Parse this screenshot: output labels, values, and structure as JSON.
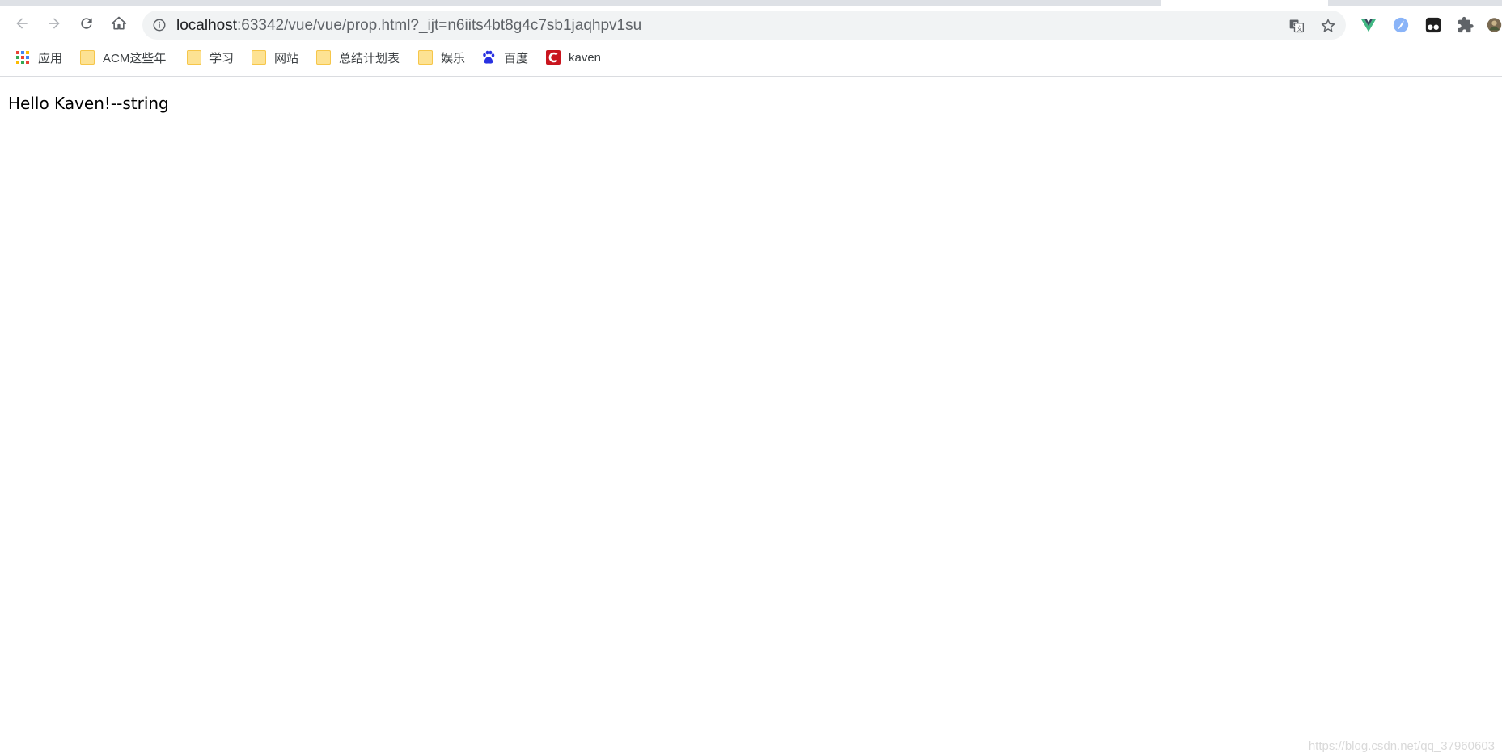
{
  "browser": {
    "url_host": "localhost",
    "url_path": ":63342/vue/vue/prop.html?_ijt=n6iits4bt8g4c7sb1jaqhpv1su"
  },
  "toolbar_icons": [
    "back-icon",
    "forward-icon",
    "reload-icon",
    "home-icon",
    "info-icon",
    "translate-icon",
    "star-icon",
    "vue-devtools-icon",
    "extension-icon-2",
    "tampermonkey-icon",
    "puzzle-icon",
    "avatar"
  ],
  "bookmarks": [
    {
      "label": "应用",
      "icon": "apps-grid-icon"
    },
    {
      "label": "ACM这些年",
      "icon": "folder-icon"
    },
    {
      "label": "学习",
      "icon": "folder-icon"
    },
    {
      "label": "网站",
      "icon": "folder-icon"
    },
    {
      "label": "总结计划表",
      "icon": "folder-icon"
    },
    {
      "label": "娱乐",
      "icon": "folder-icon"
    },
    {
      "label": "百度",
      "icon": "baidu-paw-icon"
    },
    {
      "label": "kaven",
      "icon": "csdn-icon"
    }
  ],
  "page": {
    "text": "Hello Kaven!--string"
  },
  "watermark": "https://blog.csdn.net/qq_37960603"
}
